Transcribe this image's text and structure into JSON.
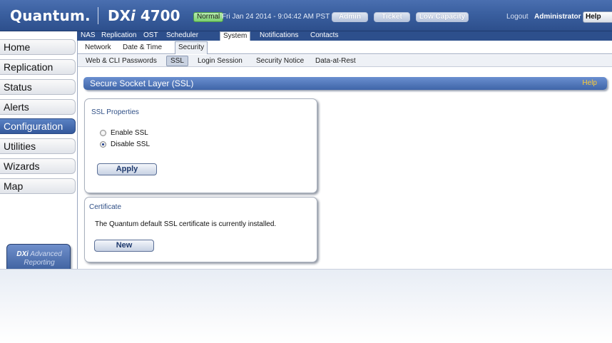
{
  "header": {
    "logo": "Quantum.",
    "product_prefix": "DX",
    "product_italic": "i",
    "product_suffix": " 4700",
    "status": "Normal",
    "datetime": "Fri Jan 24 2014 - 9:04:42 AM PST",
    "buttons": {
      "admin": "Admin",
      "ticket": "Ticket",
      "low_capacity": "Low Capacity"
    },
    "logout": "Logout",
    "user": "Administrator",
    "help": "Help"
  },
  "top_nav": {
    "items": [
      "NAS",
      "Replication",
      "OST",
      "Scheduler",
      "System",
      "Notifications",
      "Contacts"
    ],
    "active": "System"
  },
  "left_nav": {
    "items": [
      "Home",
      "Replication",
      "Status",
      "Alerts",
      "Configuration",
      "Utilities",
      "Wizards",
      "Map"
    ],
    "active": "Configuration",
    "badge_line1_bold": "DXi",
    "badge_line1_rest": " Advanced",
    "badge_line2": "Reporting"
  },
  "sub_nav": {
    "items": [
      "Network",
      "Date & Time",
      "Security"
    ],
    "active": "Security"
  },
  "security_tabs": {
    "items": [
      "Web & CLI Passwords",
      "SSL",
      "Login Session",
      "Security Notice",
      "Data-at-Rest"
    ],
    "active": "SSL"
  },
  "section": {
    "title": "Secure Socket Layer (SSL)",
    "help": "Help"
  },
  "ssl_properties": {
    "title": "SSL Properties",
    "enable_label": "Enable SSL",
    "disable_label": "Disable SSL",
    "selected": "disable",
    "apply_label": "Apply"
  },
  "certificate": {
    "title": "Certificate",
    "text": "The Quantum default SSL certificate is currently installed.",
    "new_label": "New"
  },
  "colors": {
    "header_blue": "#3a5f9f",
    "accent_blue": "#4a6fb6",
    "help_yellow": "#ffcc33",
    "status_green": "#7ccf70"
  }
}
